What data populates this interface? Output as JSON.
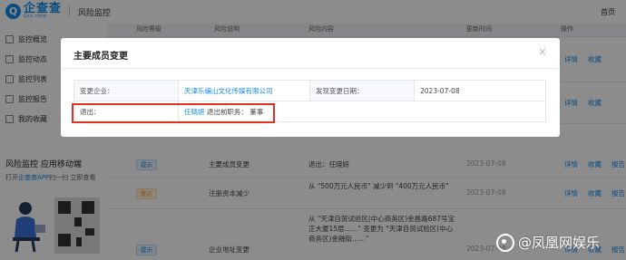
{
  "app": {
    "logo_mark": "Q",
    "logo_name": "企查查",
    "logo_sub": "Qcc.com",
    "page_title": "风险监控",
    "top_right": "首页"
  },
  "sidebar": {
    "items": [
      {
        "label": "监控概览",
        "icon": "overview-icon"
      },
      {
        "label": "监控动态",
        "icon": "activity-icon"
      },
      {
        "label": "监控列表",
        "icon": "list-icon"
      },
      {
        "label": "监控报告",
        "icon": "report-icon"
      },
      {
        "label": "我的收藏",
        "icon": "favorite-icon"
      }
    ],
    "promo": {
      "title": "风险监控  应用移动端",
      "line1_prefix": "打开",
      "line1_link": "企查查APP",
      "line1_suffix": "扫一扫 立即查看"
    }
  },
  "table": {
    "headers": [
      "风险等级",
      "风险说明",
      "风险内容",
      "更新时间",
      "操作"
    ],
    "rows": [
      {
        "level": "提示",
        "level_color": "#128bed",
        "type": "主要成员变更",
        "content": "退出：任晓妍",
        "date": "2023-07-08",
        "actions": [
          "详情",
          "收藏",
          "报告"
        ]
      },
      {
        "level": "警示",
        "level_color": "#ff8900",
        "type": "注册资本减少",
        "content": "从 \"500万元人民币\" 减少到 \"400万元人民币\"",
        "date": "2023-07-08",
        "actions": [
          "详情",
          "收藏",
          "报告"
        ]
      },
      {
        "level": "提示",
        "level_color": "#128bed",
        "type": "企业地址变更",
        "content": "从 \"天津自贸试验区(中心商务区)金昌路687号宝正大厦15层……\" 变更为 \"天津自贸试验区(中心商务区)金融街……\"",
        "date": "2023-07-08",
        "actions": [
          "详情",
          "收藏",
          "报告"
        ]
      }
    ]
  },
  "modal": {
    "title": "主要成员变更",
    "close_symbol": "×",
    "company_label": "变更企业：",
    "company_value": "天津乐编山文化传媒有限公司",
    "date_label": "发现变更日期：",
    "date_value": "2023-07-08",
    "exit_label": "退出：",
    "exit_person": "任晓妍",
    "exit_role": "退出前职务：",
    "exit_role_value": "董事"
  },
  "watermark": {
    "text": "@凤凰网娱乐"
  },
  "colors": {
    "brand": "#128bed",
    "warning": "#ff8900",
    "highlight": "#e0301e"
  }
}
